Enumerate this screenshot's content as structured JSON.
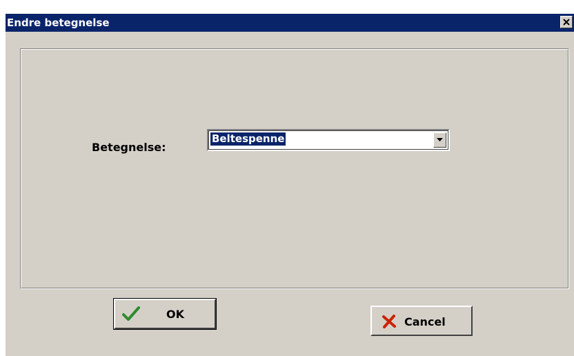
{
  "window": {
    "title": "Endre betegnelse",
    "close_icon": "close-icon"
  },
  "form": {
    "label": "Betegnelse:",
    "combo": {
      "selected_value": "Beltespenne",
      "arrow_icon": "chevron-down-icon"
    }
  },
  "buttons": {
    "ok": {
      "label": "OK",
      "icon": "checkmark-icon",
      "icon_color": "#2e8b2e"
    },
    "cancel": {
      "label": "Cancel",
      "icon": "x-icon",
      "icon_color": "#cc2200"
    }
  },
  "colors": {
    "titlebar": "#0a246a",
    "dialog_face": "#d4d0c8",
    "selection": "#0a246a"
  }
}
